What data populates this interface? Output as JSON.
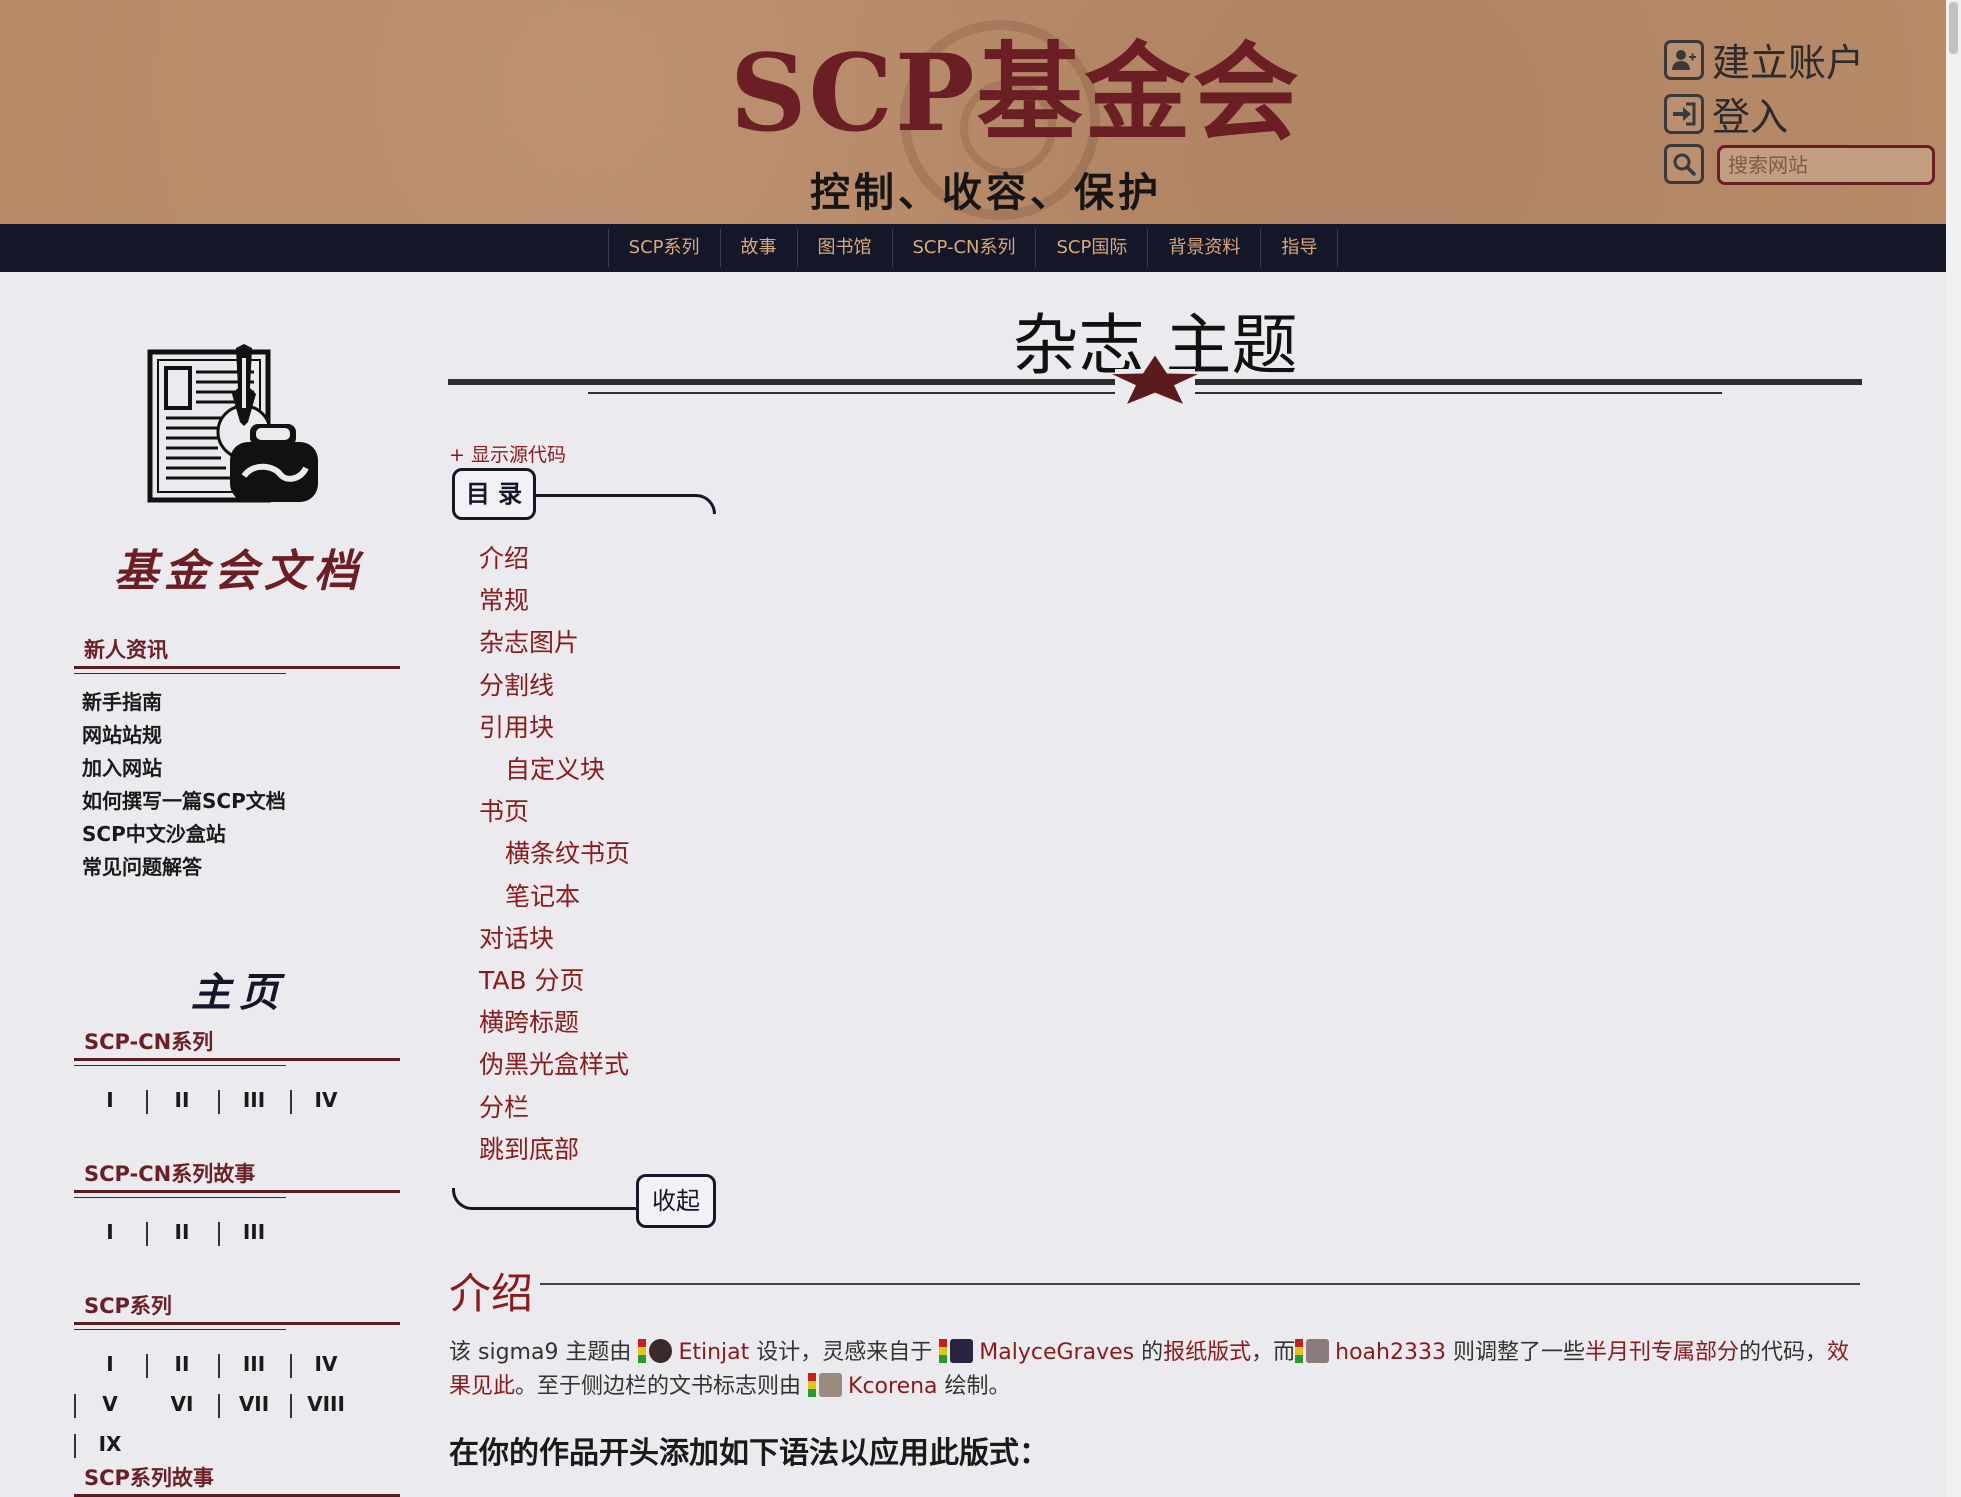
{
  "header": {
    "site_title": "SCP基金会",
    "site_subtitle": "控制、收容、保护",
    "create_account": "建立账户",
    "login": "登入",
    "search_placeholder": "搜索网站"
  },
  "nav": [
    "SCP系列",
    "故事",
    "图书馆",
    "SCP-CN系列",
    "SCP国际",
    "背景资料",
    "指导"
  ],
  "sidebar": {
    "docs_title": "基金会文档",
    "newbie_heading": "新人资讯",
    "newbie_links": [
      "新手指南",
      "网站站规",
      "加入网站",
      "如何撰写一篇SCP文档",
      "SCP中文沙盒站",
      "常见问题解答"
    ],
    "home_title": "主页",
    "cn_series_heading": "SCP-CN系列",
    "cn_series": [
      "I",
      "II",
      "III",
      "IV"
    ],
    "cn_tales_heading": "SCP-CN系列故事",
    "cn_tales": [
      "I",
      "II",
      "III"
    ],
    "series_heading": "SCP系列",
    "series": [
      "I",
      "II",
      "III",
      "IV",
      "V",
      "VI",
      "VII",
      "VIII",
      "IX"
    ],
    "series_tales_heading": "SCP系列故事"
  },
  "main": {
    "page_title": "杂志 主题",
    "show_source": "+ 显示源代码",
    "toc_heading": "目 录",
    "toc": [
      {
        "label": "介绍",
        "sub": false
      },
      {
        "label": "常规",
        "sub": false
      },
      {
        "label": "杂志图片",
        "sub": false
      },
      {
        "label": "分割线",
        "sub": false
      },
      {
        "label": "引用块",
        "sub": false
      },
      {
        "label": "自定义块",
        "sub": true
      },
      {
        "label": "书页",
        "sub": false
      },
      {
        "label": "横条纹书页",
        "sub": true
      },
      {
        "label": "笔记本",
        "sub": true
      },
      {
        "label": "对话块",
        "sub": false
      },
      {
        "label": "TAB 分页",
        "sub": false
      },
      {
        "label": "横跨标题",
        "sub": false
      },
      {
        "label": "伪黑光盒样式",
        "sub": false
      },
      {
        "label": "分栏",
        "sub": false
      },
      {
        "label": "跳到底部",
        "sub": false
      }
    ],
    "toc_collapse": "收起",
    "section_title": "介绍",
    "intro": {
      "t1": "该 sigma9 主题由",
      "user1": "Etinjat",
      "t2": "设计，灵感来自于",
      "user2": "MalyceGraves",
      "t3": "的",
      "link1": "报纸版式",
      "t4": "，而",
      "user3": "hoah2333",
      "t5": "则调整了一些",
      "link2": "半月刊专属部分",
      "t6": "的代码，",
      "link3": "效果见此",
      "t7": "。至于侧边栏的文书标志则由",
      "user4": "Kcorena",
      "t8": "绘制。"
    },
    "apply_heading": "在你的作品开头添加如下语法以应用此版式："
  },
  "colors": {
    "header_bg": "#b88a68",
    "nav_bg": "#141728",
    "nav_text": "#d9a97a",
    "accent": "#8b1a1a",
    "page_bg": "#ebebef"
  }
}
